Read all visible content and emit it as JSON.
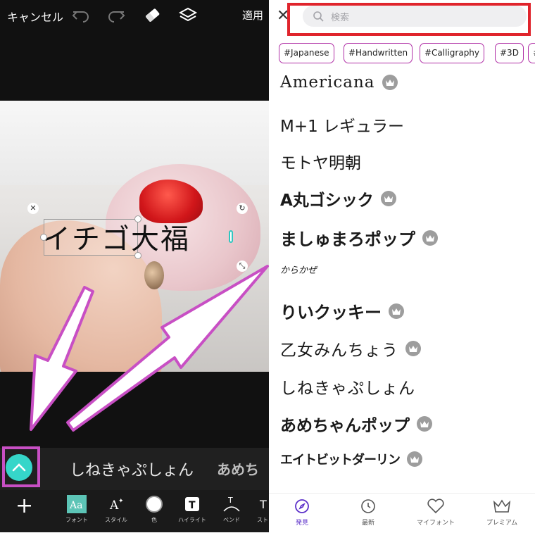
{
  "editor": {
    "cancel_label": "キャンセル",
    "apply_label": "適用",
    "canvas_text": "イチゴ大福",
    "current_font": "しねきゃぷしょん",
    "next_font_preview": "あめち",
    "tools": [
      {
        "icon": "font-icon",
        "label": "フォント"
      },
      {
        "icon": "style-icon",
        "label": "スタイル"
      },
      {
        "icon": "color-icon",
        "label": "色"
      },
      {
        "icon": "highlight-icon",
        "label": "ハイライト"
      },
      {
        "icon": "bend-icon",
        "label": "ベンド"
      },
      {
        "icon": "stroke-icon",
        "label": "スト"
      }
    ],
    "accent": "#35d6c9"
  },
  "panel": {
    "search_placeholder": "検索",
    "tags": [
      "#Japanese",
      "#Handwritten",
      "#Calligraphy",
      "#3D",
      "#"
    ],
    "fonts": [
      {
        "name": "Americana",
        "premium": true
      },
      {
        "name": "M+1 レギュラー",
        "premium": false
      },
      {
        "name": "モトヤ明朝",
        "premium": false
      },
      {
        "name": "A丸ゴシック",
        "premium": true
      },
      {
        "name": "ましゅまろポップ",
        "premium": true
      },
      {
        "name": "からかぜ",
        "premium": false
      },
      {
        "name": "りいクッキー",
        "premium": true
      },
      {
        "name": "乙女みんちょう",
        "premium": true
      },
      {
        "name": "しねきゃぷしょん",
        "premium": false
      },
      {
        "name": "あめちゃんポップ",
        "premium": true
      },
      {
        "name": "エイトビットダーリン",
        "premium": true
      }
    ],
    "tabs": [
      {
        "icon": "compass-icon",
        "label": "発見",
        "active": true
      },
      {
        "icon": "clock-icon",
        "label": "最新",
        "active": false
      },
      {
        "icon": "heart-icon",
        "label": "マイフォント",
        "active": false
      },
      {
        "icon": "crown-icon",
        "label": "プレミアム",
        "active": false
      }
    ],
    "tag_border_color": "#b02fa6",
    "active_tab_color": "#5b2fc9"
  },
  "annotations": {
    "highlight_box_color": "#e0242c",
    "arrow_color": "#c84fc4"
  }
}
